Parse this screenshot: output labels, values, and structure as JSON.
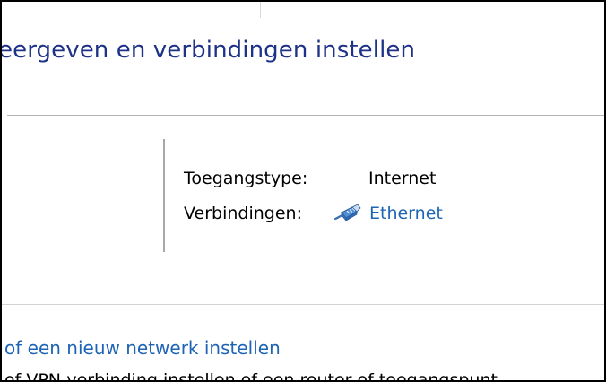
{
  "page": {
    "heading": "eergeven en verbindingen instellen"
  },
  "network": {
    "access_type_label": "Toegangstype:",
    "access_type_value": "Internet",
    "connections_label": "Verbindingen:",
    "connection_name": "Ethernet",
    "connection_icon": "ethernet-cable-icon"
  },
  "tasks": {
    "new_network_link": "of een nieuw netwerk instellen",
    "new_network_description": "of VPN-verbinding instellen of een router of toegangspunt"
  },
  "colors": {
    "heading": "#1e3287",
    "link": "#1e64b4",
    "frame_border": "#000000"
  }
}
